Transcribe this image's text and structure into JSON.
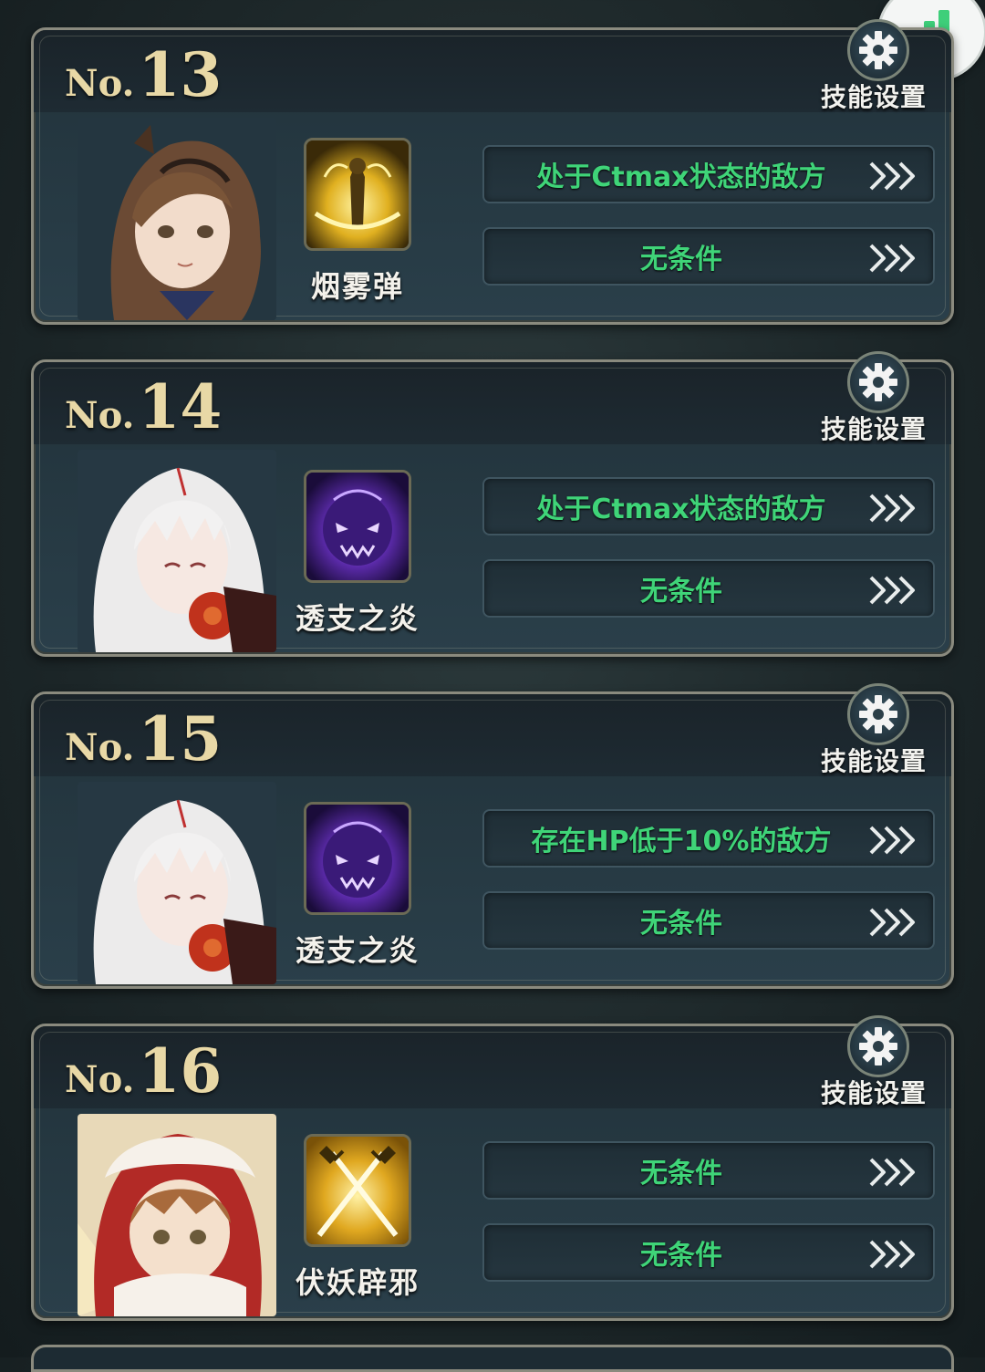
{
  "skill_settings_label": "技能设置",
  "entries": [
    {
      "no_prefix": "No.",
      "number": "13",
      "skill_name": "烟雾弹",
      "conditions": [
        "处于Ctmax状态的敌方",
        "无条件"
      ],
      "portrait": "brown-haired-girl-portrait",
      "skill_icon": "smoke-bomb-icon"
    },
    {
      "no_prefix": "No.",
      "number": "14",
      "skill_name": "透支之炎",
      "conditions": [
        "处于Ctmax状态的敌方",
        "无条件"
      ],
      "portrait": "white-haired-girl-portrait",
      "skill_icon": "purple-flame-icon"
    },
    {
      "no_prefix": "No.",
      "number": "15",
      "skill_name": "透支之炎",
      "conditions": [
        "存在HP低于10%的敌方",
        "无条件"
      ],
      "portrait": "white-haired-girl-portrait",
      "skill_icon": "purple-flame-icon"
    },
    {
      "no_prefix": "No.",
      "number": "16",
      "skill_name": "伏妖辟邪",
      "conditions": [
        "无条件",
        "无条件"
      ],
      "portrait": "winter-hood-girl-portrait",
      "skill_icon": "crossed-swords-icon"
    }
  ],
  "colors": {
    "condition_text": "#3fd478",
    "number_gold": "#e8d8a6",
    "signal_green": "#3ecf7a"
  }
}
